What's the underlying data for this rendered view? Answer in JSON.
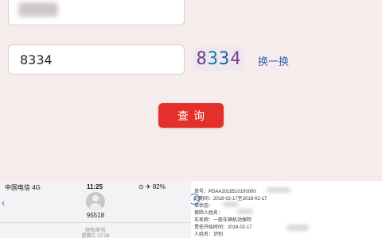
{
  "form": {
    "captcha_value": "8334",
    "captcha_digits": [
      "8",
      "3",
      "3",
      "4"
    ],
    "refresh_label": "换一换",
    "query_label": "查询"
  },
  "phone": {
    "carrier": "中国电信 4G",
    "time": "11:25",
    "status_right": "⊙ ✈ 82%",
    "contact_number": "95518",
    "msg_label": "短信/彩信",
    "msg_time": "星期三 17:28"
  },
  "doc": {
    "lines": [
      "单号：PDAA2018510100000",
      "起期间：2018-02-17至2018-02-17",
      "单状态：",
      "保险人姓名：",
      "车名称：一般车辆机动保险",
      "责任开始时间：2018-02-17",
      "人姓名：识别"
    ]
  },
  "colors": {
    "query_button": "#e3302a",
    "refresh_link": "#3b5fb0",
    "background": "#f6ecec"
  }
}
